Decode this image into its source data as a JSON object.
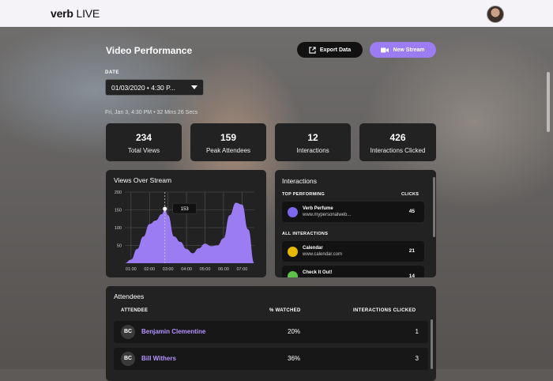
{
  "app": {
    "brand_bold": "verb",
    "brand_light": "LIVE"
  },
  "page": {
    "title": "Video Performance"
  },
  "actions": {
    "export_label": "Export Data",
    "new_stream_label": "New Stream"
  },
  "filter": {
    "date_label": "DATE",
    "date_value": "01/03/2020 • 4:30 P..."
  },
  "stream_info": "Fri, Jan 3, 4:30 PM  •  32 Mins 26 Secs",
  "stats": [
    {
      "value": "234",
      "label": "Total Views"
    },
    {
      "value": "159",
      "label": "Peak Attendees"
    },
    {
      "value": "12",
      "label": "Interactions"
    },
    {
      "value": "426",
      "label": "Interactions Clicked"
    }
  ],
  "views_chart": {
    "title": "Views Over Stream",
    "tooltip": "153"
  },
  "chart_data": {
    "type": "area",
    "title": "Views Over Stream",
    "xlabel": "",
    "ylabel": "",
    "x_ticks": [
      "01:00",
      "02:00",
      "03:00",
      "04:00",
      "05:00",
      "06:00",
      "07:00"
    ],
    "y_ticks": [
      50,
      100,
      150,
      200
    ],
    "ylim": [
      0,
      200
    ],
    "grid": true,
    "color": "#9b7cf2",
    "highlight": {
      "x": "02:50",
      "y": 153
    },
    "x": [
      "00:40",
      "01:00",
      "01:20",
      "01:40",
      "02:00",
      "02:20",
      "02:40",
      "02:50",
      "03:00",
      "03:20",
      "03:40",
      "04:00",
      "04:20",
      "04:40",
      "05:00",
      "05:20",
      "05:40",
      "06:00",
      "06:20",
      "06:40",
      "07:00",
      "07:20",
      "07:40"
    ],
    "values": [
      0,
      10,
      40,
      75,
      110,
      120,
      138,
      153,
      135,
      75,
      60,
      40,
      28,
      42,
      55,
      48,
      50,
      70,
      135,
      170,
      165,
      95,
      0
    ]
  },
  "interactions": {
    "title": "Interactions",
    "top_label": "TOP PERFORMING",
    "clicks_label": "CLICKS",
    "all_label": "ALL INTERACTIONS",
    "top": [
      {
        "name": "Verb Perfume",
        "url": "www.mypersonalweb...",
        "clicks": "45",
        "icon_color": "#7b68ee"
      }
    ],
    "all": [
      {
        "name": "Calendar",
        "url": "www.calendar.com",
        "clicks": "21",
        "icon_color": "#e6b800"
      },
      {
        "name": "Check It Out!",
        "url": "",
        "clicks": "14",
        "icon_color": "#5fc04a"
      }
    ]
  },
  "attendees": {
    "title": "Attendees",
    "col_attendee": "ATTENDEE",
    "col_watched": "% WATCHED",
    "col_clicked": "INTERACTIONS CLICKED",
    "rows": [
      {
        "initials": "BC",
        "name": "Benjamin Clementine",
        "watched": "20%",
        "clicked": "1"
      },
      {
        "initials": "BC",
        "name": "Bill Withers",
        "watched": "36%",
        "clicked": "3"
      }
    ]
  }
}
